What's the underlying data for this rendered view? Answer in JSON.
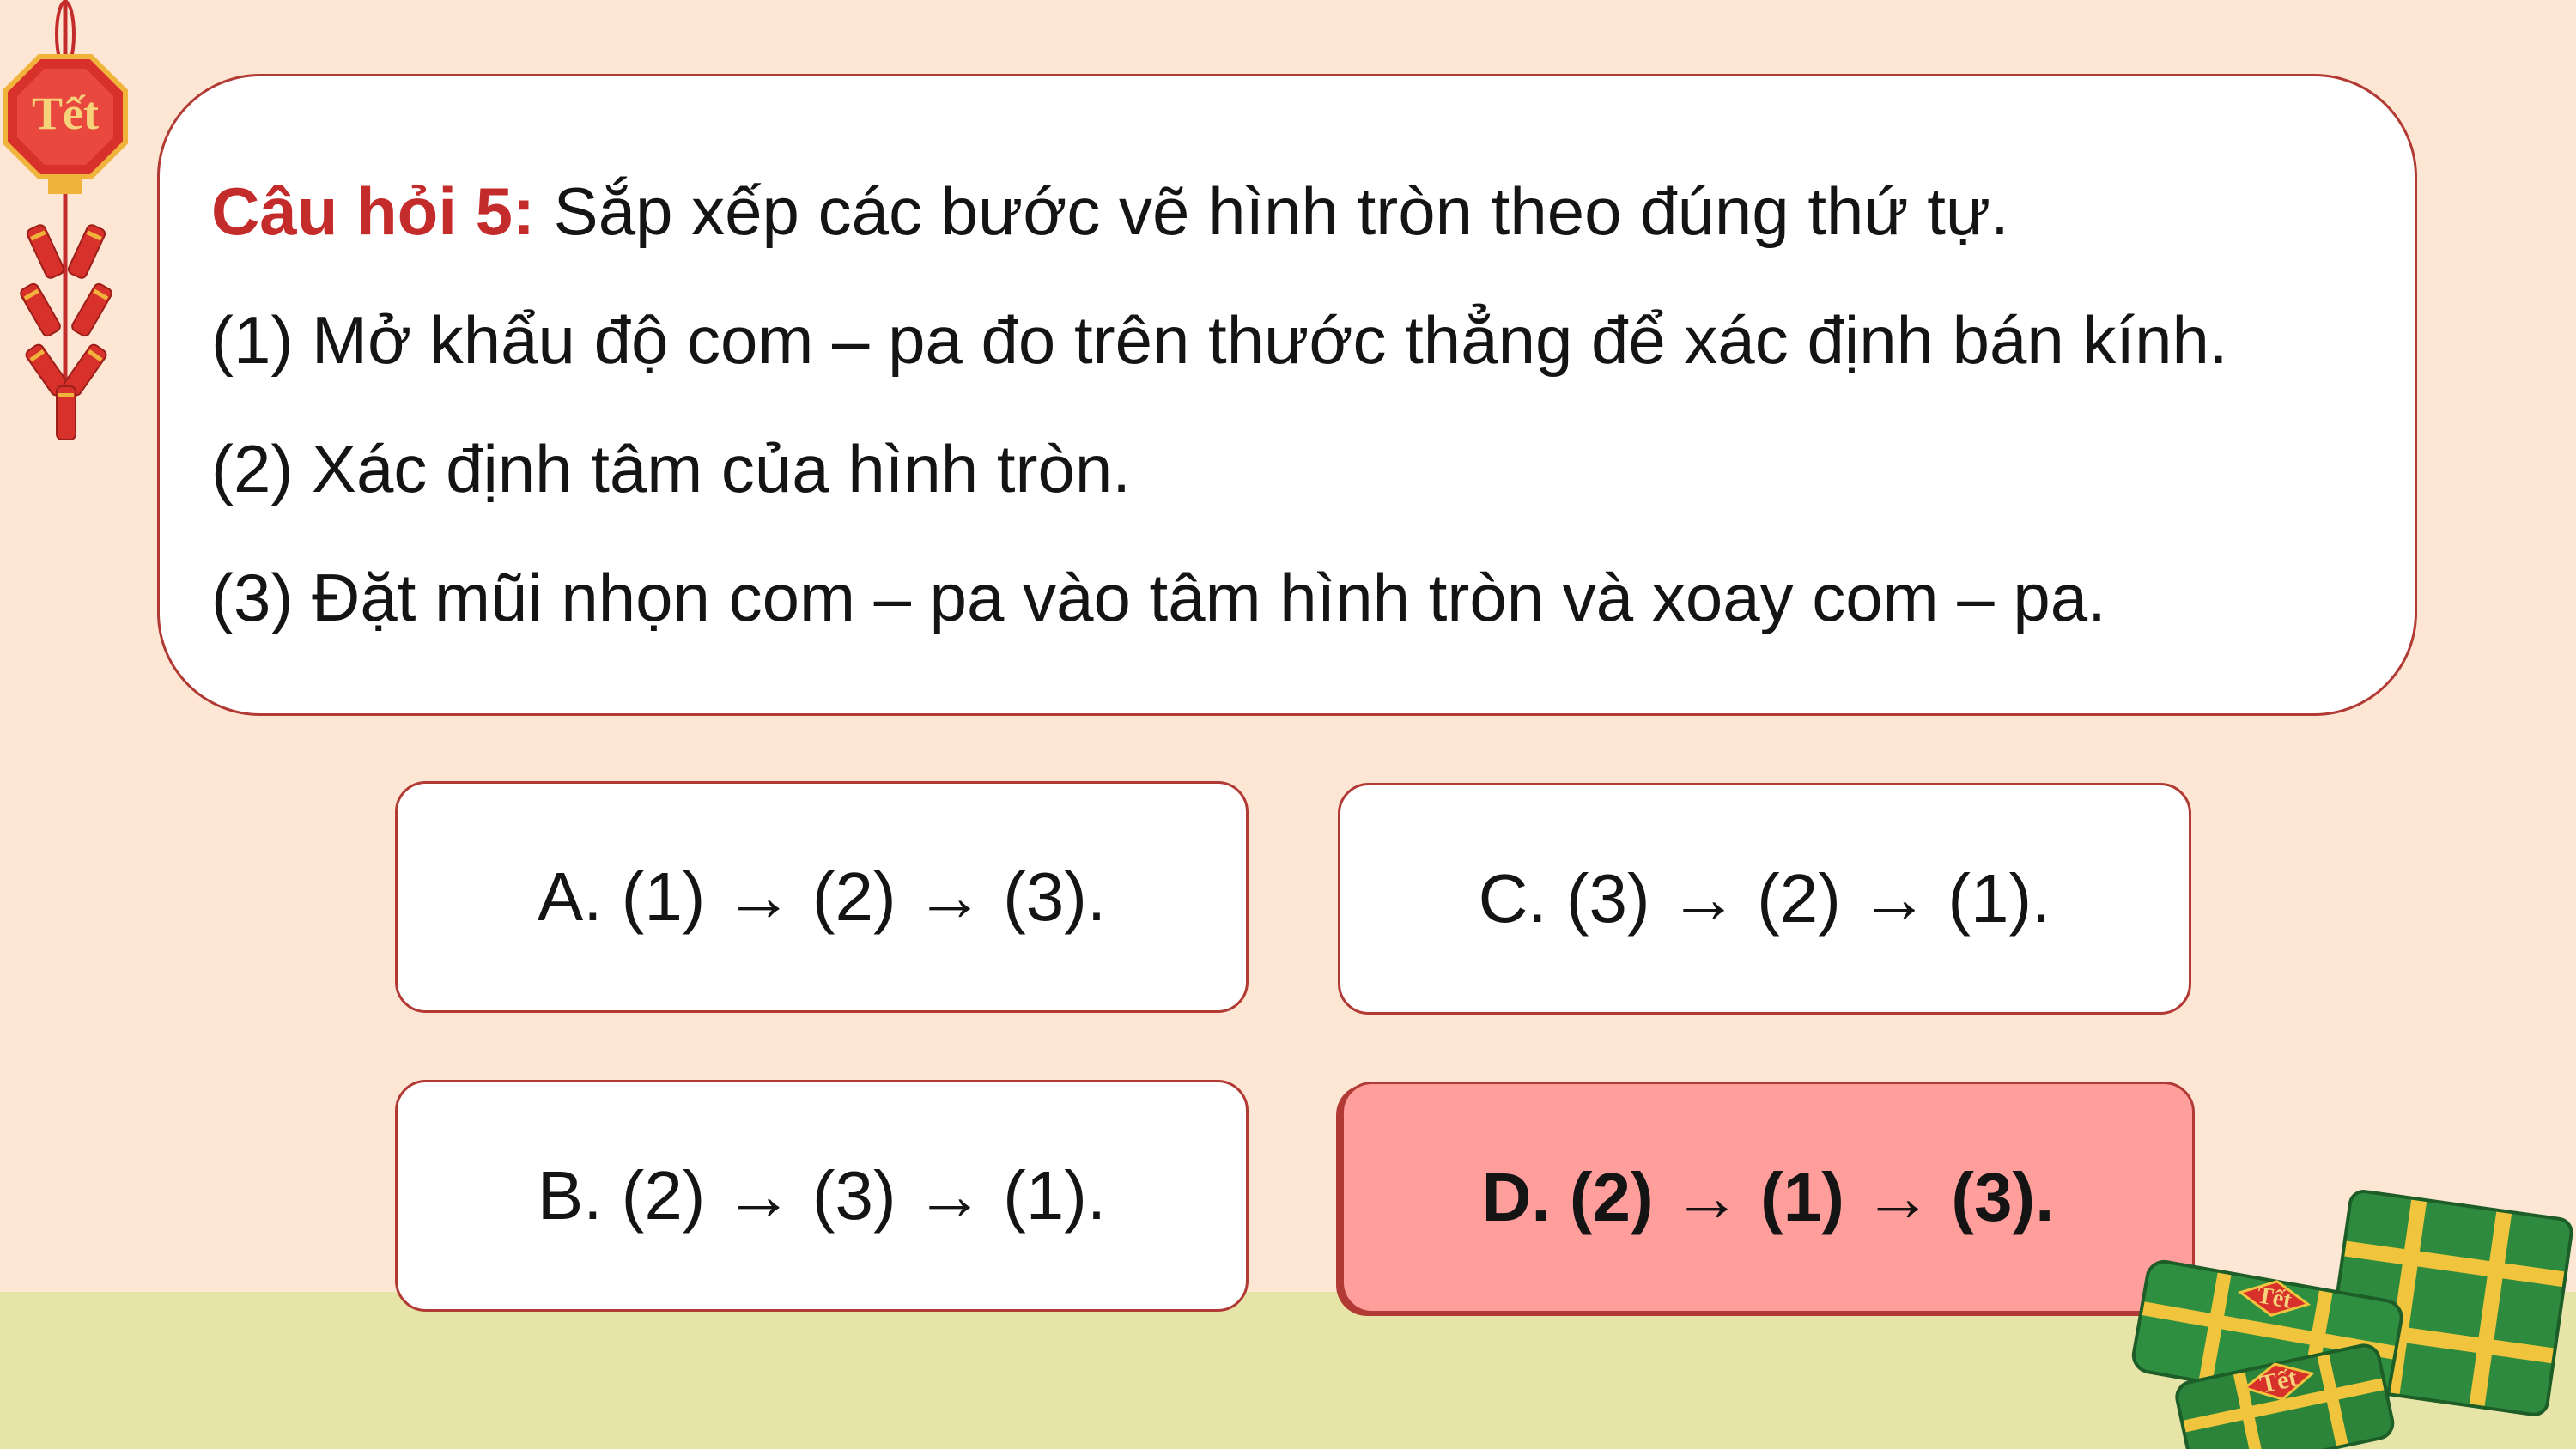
{
  "question": {
    "label": "Câu hỏi 5:",
    "text": " Sắp xếp các bước vẽ hình tròn theo đúng thứ tự.",
    "steps": [
      "(1) Mở khẩu độ com – pa đo trên thước thẳng để xác định bán kính.",
      "(2) Xác định tâm của hình tròn.",
      "(3) Đặt mũi nhọn com – pa vào tâm hình tròn và xoay com – pa."
    ]
  },
  "answers": {
    "a": "A. (1) → (2) → (3).",
    "b": "B. (2) → (3) → (1).",
    "c": "C. (3) → (2) → (1).",
    "d": "D. (2) → (1) → (3)."
  },
  "highlighted_answer": "d",
  "decor": {
    "tet_label": "Tết"
  },
  "colors": {
    "background": "#fde7d4",
    "ground": "#e7e4a8",
    "border": "#b23a34",
    "label": "#c42b2b",
    "correct_fill": "#ff9e9b"
  }
}
